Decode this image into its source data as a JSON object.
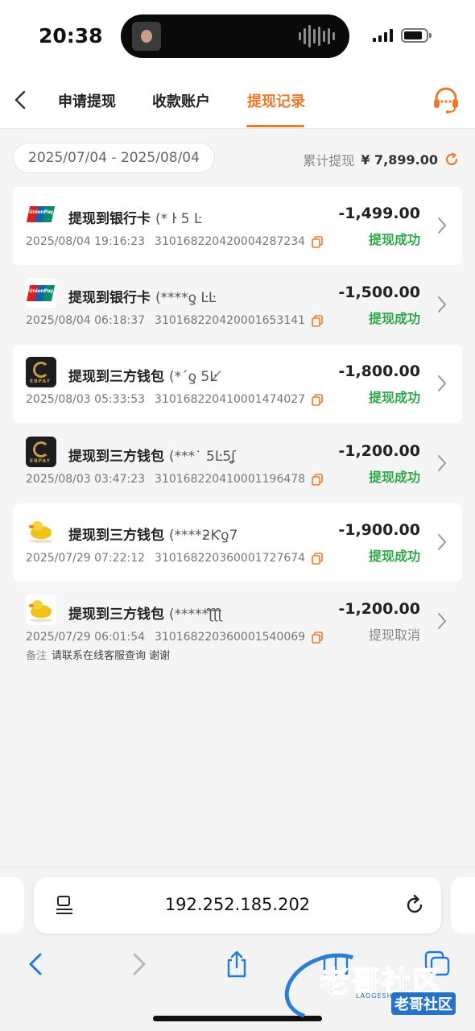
{
  "status_bar": {
    "time": "20:38"
  },
  "header": {
    "tabs": [
      {
        "label": "申请提现"
      },
      {
        "label": "收款账户"
      },
      {
        "label": "提现记录"
      }
    ],
    "active_tab": "提现记录",
    "accent_color": "#ec7a2a"
  },
  "filter": {
    "date_range": "2025/07/04 - 2025/08/04",
    "total_label": "累计提现",
    "total_amount": "¥ 7,899.00"
  },
  "records": [
    {
      "logo": "unionpay-icon",
      "title": "提现到银行卡",
      "account": "(* ŀ 5 Ŀ",
      "datetime": "2025/08/04 19:16:23",
      "txid": "3101682204200042​87234",
      "amount": "-1,499.00",
      "status": "提现成功",
      "status_type": "success"
    },
    {
      "logo": "unionpay-icon",
      "title": "提现到银行卡",
      "account": "(****ƍ ĿĿ",
      "datetime": "2025/08/04 06:18:37",
      "txid": "310168220420001653141",
      "amount": "-1,500.00",
      "status": "提现成功",
      "status_type": "success"
    },
    {
      "logo": "ebpay-icon",
      "title": "提现到三方钱包",
      "account": "(*ˊƍ 5Ŀ ̸",
      "datetime": "2025/08/03 05:33:53",
      "txid": "310168220410001474027",
      "amount": "-1,800.00",
      "status": "提现成功",
      "status_type": "success"
    },
    {
      "logo": "ebpay-icon",
      "title": "提现到三方钱包",
      "account": "(***˙ 5Ŀ5ʆ",
      "datetime": "2025/08/03 03:47:23",
      "txid": "310168220410001196478",
      "amount": "-1,200.00",
      "status": "提现成功",
      "status_type": "success"
    },
    {
      "logo": "duck-icon",
      "title": "提现到三方钱包",
      "account": "(****ƻƘƍ7",
      "datetime": "2025/07/29 07:22:12",
      "txid": "310168220360001727674",
      "amount": "-1,900.00",
      "status": "提现成功",
      "status_type": "success"
    },
    {
      "logo": "duck-icon",
      "title": "提现到三方钱包",
      "account": "(*****ƪƪƪ",
      "datetime": "2025/07/29 06:01:54",
      "txid": "310168220360001540069",
      "amount": "-1,200.00",
      "status": "提现取消",
      "status_type": "cancel",
      "remark_label": "备注",
      "remark": "请联系在线客服查询 谢谢"
    }
  ],
  "browser": {
    "url": "192.252.185.202"
  },
  "watermark": {
    "text": "老哥社区",
    "badge": "老哥社区",
    "sub": "LAOGESHEQU"
  },
  "colors": {
    "success": "#2fa84a",
    "cancel": "#888888",
    "accent": "#ec7a2a"
  }
}
